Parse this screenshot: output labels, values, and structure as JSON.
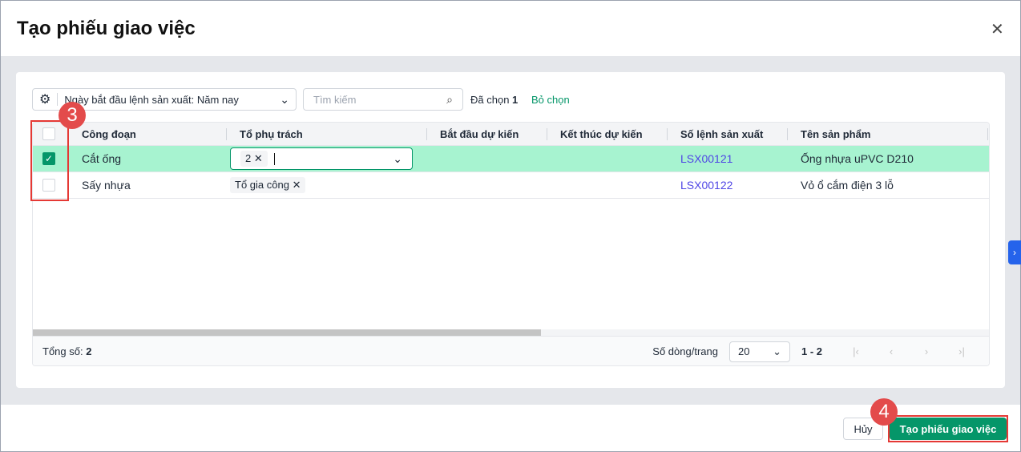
{
  "dialog": {
    "title": "Tạo phiếu giao việc",
    "close": "✕"
  },
  "toolbar": {
    "filter_label": "Ngày bắt đầu lệnh sản xuất: Năm nay",
    "search_placeholder": "Tìm kiếm",
    "selected_label": "Đã chọn",
    "selected_count": "1",
    "unselect": "Bỏ chọn"
  },
  "table": {
    "columns": [
      "Công đoạn",
      "Tổ phụ trách",
      "Bắt đầu dự kiến",
      "Kết thúc dự kiến",
      "Số lệnh sản xuất",
      "Tên sản phẩm"
    ],
    "rows": [
      {
        "stage": "Cắt ống",
        "team_tag": "2",
        "start": "",
        "end": "",
        "order": "LSX00121",
        "product": "Ống nhựa uPVC D210",
        "checked": true
      },
      {
        "stage": "Sấy nhựa",
        "team_tag": "Tổ gia công",
        "start": "",
        "end": "",
        "order": "LSX00122",
        "product": "Vỏ ổ cắm điện 3 lỗ",
        "checked": false
      }
    ]
  },
  "footer": {
    "total_label": "Tổng số:",
    "total": "2",
    "rows_per_page_label": "Số dòng/trang",
    "rows_per_page": "20",
    "range": "1 - 2"
  },
  "actions": {
    "cancel": "Hủy",
    "create": "Tạo phiếu giao việc"
  },
  "annotations": {
    "step3": "3",
    "step4": "4"
  },
  "colors": {
    "accent": "#059669",
    "selected_row": "#a7f3d0",
    "link": "#4f46e5"
  }
}
